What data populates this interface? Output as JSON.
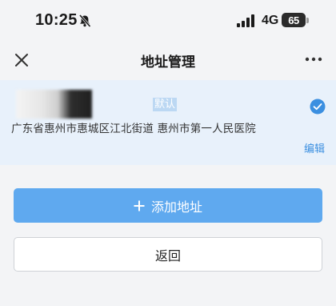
{
  "status_bar": {
    "time": "10:25",
    "network": "4G",
    "battery": "65"
  },
  "nav": {
    "title": "地址管理",
    "close_icon": "close-icon",
    "more_icon": "more-icon"
  },
  "address": {
    "default_tag": "默认",
    "text": "广东省惠州市惠城区江北街道 惠州市第一人民医院",
    "edit_label": "编辑",
    "selected": true
  },
  "actions": {
    "add_label": "添加地址",
    "back_label": "返回"
  },
  "colors": {
    "accent": "#3b8fe0",
    "add_button": "#5fa9ef",
    "card_bg": "#e8f1fb"
  }
}
